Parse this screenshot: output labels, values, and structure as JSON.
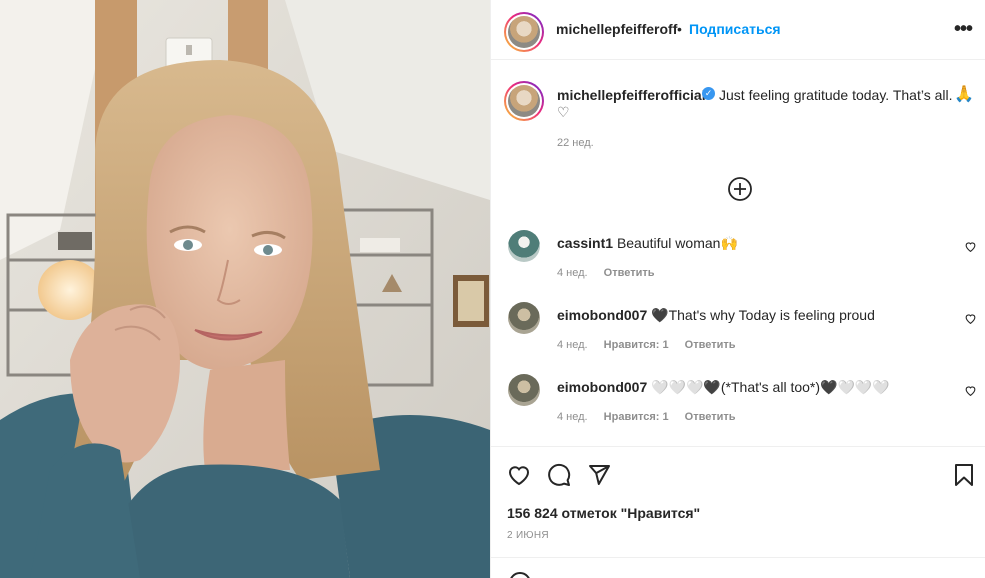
{
  "header": {
    "username": "michellepfeifferoff",
    "separator": "•",
    "follow_label": "Подписаться",
    "more_icon": "more-horizontal-icon"
  },
  "caption": {
    "username": "michellepfeifferofficial",
    "verified": true,
    "text": "Just feeling gratitude today. That’s all.",
    "emoji_pray": "🙏",
    "emoji_heart": "♡",
    "time": "22 нед."
  },
  "load_more_icon": "plus-circle-icon",
  "comments": [
    {
      "username": "cassint1",
      "text": "Beautiful woman🙌",
      "time": "4 нед.",
      "likes_label": "",
      "reply_label": "Ответить"
    },
    {
      "username": "eimobond007",
      "text": "🖤That's why Today is feeling proud",
      "time": "4 нед.",
      "likes_label": "Нравится: 1",
      "reply_label": "Ответить"
    },
    {
      "username": "eimobond007",
      "text": "🤍🤍🤍🖤(*That's all too*)🖤🤍🤍🤍",
      "time": "4 нед.",
      "likes_label": "Нравится: 1",
      "reply_label": "Ответить"
    }
  ],
  "actions": {
    "like_icon": "heart-icon",
    "comment_icon": "comment-icon",
    "share_icon": "share-icon",
    "save_icon": "bookmark-icon"
  },
  "likes_text": "156 824 отметок \"Нравится\"",
  "post_date": "2 ИЮНЯ",
  "colors": {
    "accent": "#0095f6",
    "text": "#262626",
    "muted": "#8e8e8e",
    "border": "#efefef"
  }
}
